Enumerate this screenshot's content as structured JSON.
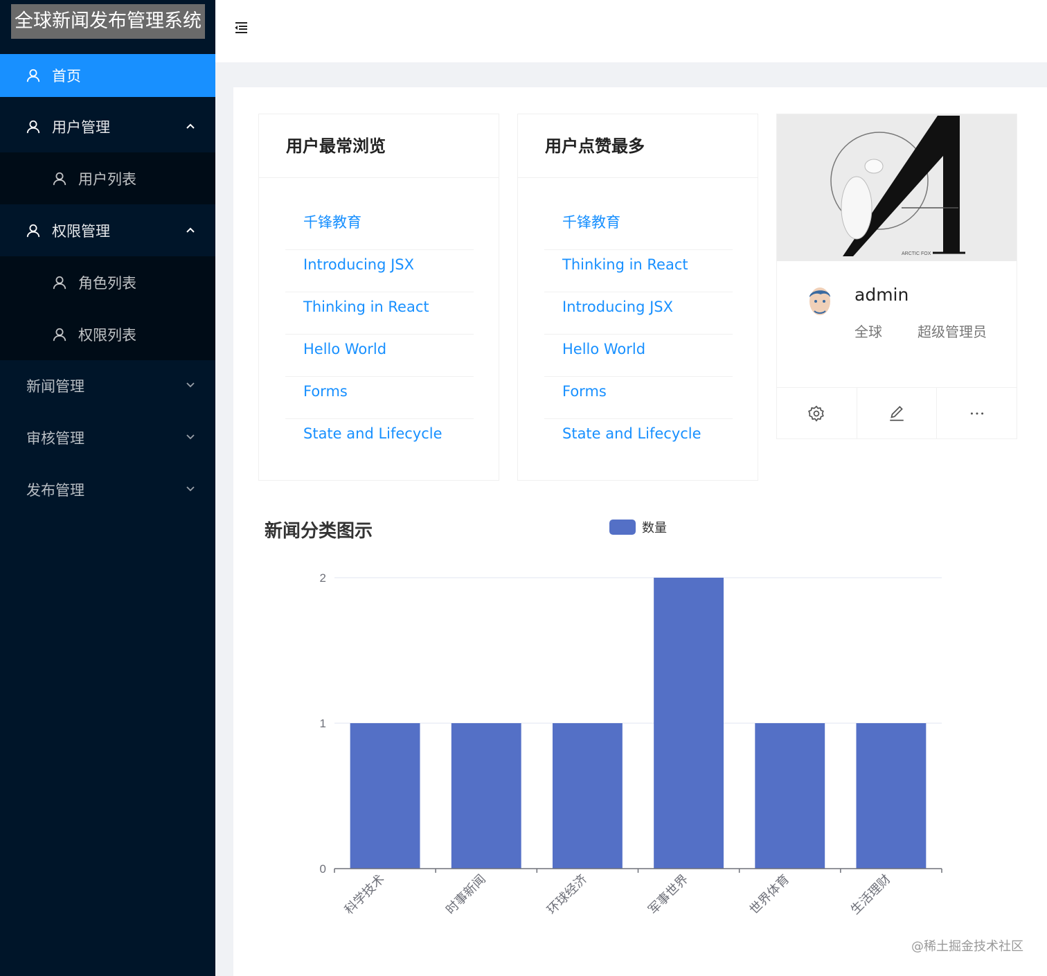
{
  "app": {
    "title": "全球新闻发布管理系统"
  },
  "sidebar": {
    "items": [
      {
        "label": "首页"
      },
      {
        "label": "用户管理"
      },
      {
        "label": "用户列表"
      },
      {
        "label": "权限管理"
      },
      {
        "label": "角色列表"
      },
      {
        "label": "权限列表"
      },
      {
        "label": "新闻管理"
      },
      {
        "label": "审核管理"
      },
      {
        "label": "发布管理"
      }
    ]
  },
  "cards": {
    "most_viewed": {
      "title": "用户最常浏览",
      "items": [
        "千锋教育",
        "Introducing JSX",
        "Thinking in React",
        "Hello World",
        "Forms",
        "State and Lifecycle"
      ]
    },
    "most_liked": {
      "title": "用户点赞最多",
      "items": [
        "千锋教育",
        "Thinking in React",
        "Introducing JSX",
        "Hello World",
        "Forms",
        "State and Lifecycle"
      ]
    }
  },
  "profile": {
    "cover_text": "ARCTIC FOX",
    "username": "admin",
    "region": "全球",
    "role": "超级管理员",
    "actions": [
      "gear-icon",
      "edit-icon",
      "ellipsis-icon"
    ]
  },
  "chart_data": {
    "type": "bar",
    "title": "新闻分类图示",
    "categories": [
      "科学技术",
      "时事新闻",
      "环球经济",
      "军事世界",
      "世界体育",
      "生活理财"
    ],
    "series": [
      {
        "name": "数量",
        "values": [
          1,
          1,
          1,
          2,
          1,
          1
        ]
      }
    ],
    "ylim": [
      0,
      2
    ],
    "yticks": [
      0,
      1,
      2
    ],
    "color": "#5470c6",
    "legend": "top-center",
    "grid": true
  },
  "watermark": "@稀土掘金技术社区"
}
